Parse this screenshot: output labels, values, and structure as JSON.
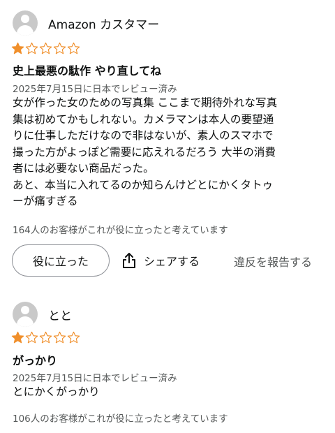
{
  "colors": {
    "star_filled": "#f08f2b",
    "star_outline": "#f08f2b",
    "muted": "#565959"
  },
  "reviews": [
    {
      "reviewer": "Amazon カスタマー",
      "rating": 1,
      "rating_max": 5,
      "title": "史上最悪の駄作 やり直してね",
      "date": "2025年7月15日に日本でレビュー済み",
      "body_lines": [
        "女が作った女のための写真集 ここまで期待外れな写真",
        "集は初めてかもしれない。カメラマンは本人の要望通",
        "りに仕事しただけなので非はないが、素人のスマホで",
        "撮った方がよっぽど需要に応えれるだろう 大半の消費",
        "者には必要ない商品だった。",
        "あと、本当に入れてるのか知らんけどとにかくタトゥ",
        "ーが痛すぎる"
      ],
      "helpful_text": "164人のお客様がこれが役に立ったと考えています",
      "helpful_button": "役に立った",
      "share_label": "シェアする",
      "report_label": "違反を報告する"
    },
    {
      "reviewer": "とと",
      "rating": 1,
      "rating_max": 5,
      "title": "がっかり",
      "date": "2025年7月15日に日本でレビュー済み",
      "body_lines": [
        "とにかくがっかり"
      ],
      "helpful_text": "106人のお客様がこれが役に立ったと考えています"
    }
  ]
}
